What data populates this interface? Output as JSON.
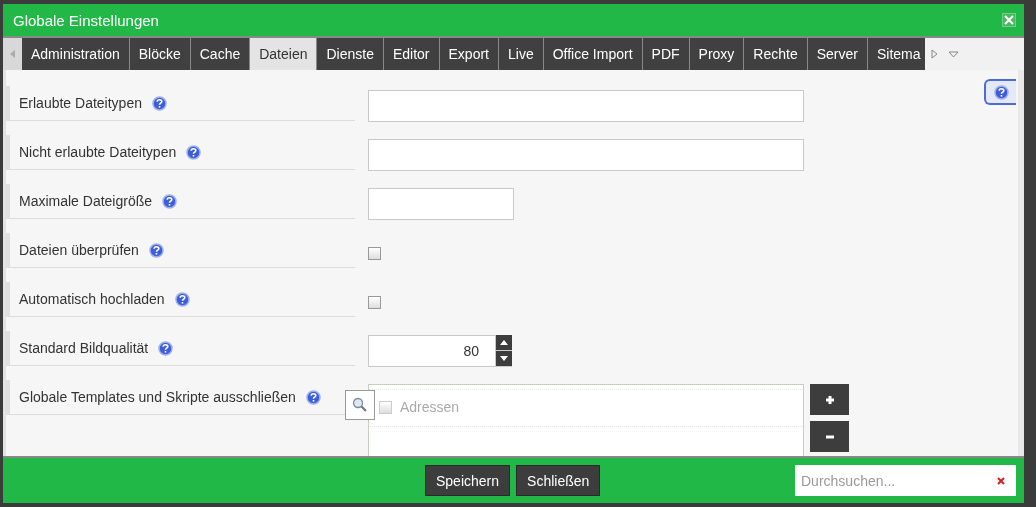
{
  "window": {
    "title": "Globale Einstellungen"
  },
  "tabs": [
    {
      "label": "Administration",
      "selected": false
    },
    {
      "label": "Blöcke",
      "selected": false
    },
    {
      "label": "Cache",
      "selected": false
    },
    {
      "label": "Dateien",
      "selected": true
    },
    {
      "label": "Dienste",
      "selected": false
    },
    {
      "label": "Editor",
      "selected": false
    },
    {
      "label": "Export",
      "selected": false
    },
    {
      "label": "Live",
      "selected": false
    },
    {
      "label": "Office Import",
      "selected": false
    },
    {
      "label": "PDF",
      "selected": false
    },
    {
      "label": "Proxy",
      "selected": false
    },
    {
      "label": "Rechte",
      "selected": false
    },
    {
      "label": "Server",
      "selected": false
    },
    {
      "label": "Sitema",
      "selected": false
    }
  ],
  "fields": [
    {
      "kind": "text",
      "label": "Erlaubte Dateitypen"
    },
    {
      "kind": "text",
      "label": "Nicht erlaubte Dateitypen"
    },
    {
      "kind": "short_text",
      "label": "Maximale Dateigröße"
    },
    {
      "kind": "checkbox",
      "label": "Dateien überprüfen",
      "checked": false
    },
    {
      "kind": "checkbox",
      "label": "Automatisch hochladen",
      "checked": false
    },
    {
      "kind": "number",
      "label": "Standard Bildqualität",
      "value": "80"
    },
    {
      "kind": "list",
      "label": "Globale Templates und Skripte ausschließen",
      "items": [
        {
          "label": "Adressen",
          "checked": false
        }
      ]
    }
  ],
  "footer": {
    "buttons": [
      "Speichern",
      "Schließen"
    ],
    "search": {
      "placeholder": "Durchsuchen..."
    }
  }
}
